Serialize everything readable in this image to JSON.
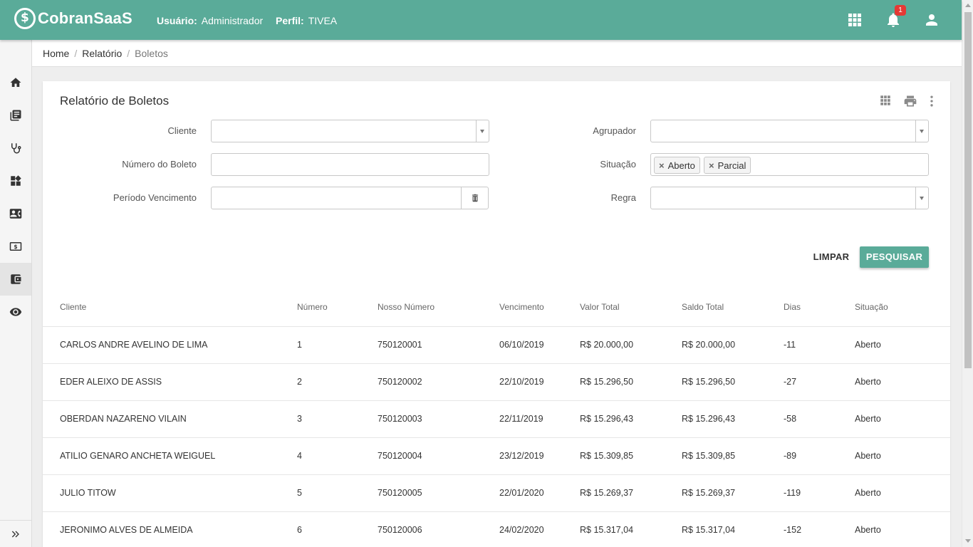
{
  "app": {
    "logo_text": "CobranSaaS"
  },
  "header": {
    "user_label": "Usuário:",
    "user_value": "Administrador",
    "profile_label": "Perfil:",
    "profile_value": "TIVEA",
    "notification_count": "1"
  },
  "sidebar": {
    "items": [
      {
        "icon": "home-icon"
      },
      {
        "icon": "library-books-icon"
      },
      {
        "icon": "stethoscope-icon"
      },
      {
        "icon": "dashboard-widgets-icon"
      },
      {
        "icon": "contact-card-icon"
      },
      {
        "icon": "money-icon"
      },
      {
        "icon": "wallet-icon",
        "active": true
      },
      {
        "icon": "eye-icon"
      }
    ],
    "expand_icon": "double-chevron-right-icon"
  },
  "breadcrumb": {
    "items": [
      "Home",
      "Relatório"
    ],
    "current": "Boletos"
  },
  "page": {
    "title": "Relatório de Boletos",
    "tools": [
      "grid-icon",
      "print-icon",
      "more-vert-icon"
    ]
  },
  "filters": {
    "cliente_label": "Cliente",
    "cliente_value": "",
    "numero_label": "Número do Boleto",
    "numero_value": "",
    "periodo_label": "Período Vencimento",
    "periodo_value": "",
    "agrupador_label": "Agrupador",
    "agrupador_value": "",
    "situacao_label": "Situação",
    "situacao_chips": [
      "Aberto",
      "Parcial"
    ],
    "regra_label": "Regra",
    "regra_value": ""
  },
  "actions": {
    "clear_label": "LIMPAR",
    "search_label": "PESQUISAR"
  },
  "table": {
    "columns": [
      "Cliente",
      "Número",
      "Nosso Número",
      "Vencimento",
      "Valor Total",
      "Saldo Total",
      "Dias",
      "Situação"
    ],
    "rows": [
      [
        "CARLOS ANDRE AVELINO DE LIMA",
        "1",
        "750120001",
        "06/10/2019",
        "R$ 20.000,00",
        "R$ 20.000,00",
        "-11",
        "Aberto"
      ],
      [
        "EDER ALEIXO DE ASSIS",
        "2",
        "750120002",
        "22/10/2019",
        "R$ 15.296,50",
        "R$ 15.296,50",
        "-27",
        "Aberto"
      ],
      [
        "OBERDAN NAZARENO VILAIN",
        "3",
        "750120003",
        "22/11/2019",
        "R$ 15.296,43",
        "R$ 15.296,43",
        "-58",
        "Aberto"
      ],
      [
        "ATILIO GENARO ANCHETA WEIGUEL",
        "4",
        "750120004",
        "23/12/2019",
        "R$ 15.309,85",
        "R$ 15.309,85",
        "-89",
        "Aberto"
      ],
      [
        "JULIO TITOW",
        "5",
        "750120005",
        "22/01/2020",
        "R$ 15.269,37",
        "R$ 15.269,37",
        "-119",
        "Aberto"
      ],
      [
        "JERONIMO ALVES DE ALMEIDA",
        "6",
        "750120006",
        "24/02/2020",
        "R$ 15.317,04",
        "R$ 15.317,04",
        "-152",
        "Aberto"
      ]
    ]
  },
  "colors": {
    "brand": "#5aab99",
    "badge": "#e53935"
  }
}
